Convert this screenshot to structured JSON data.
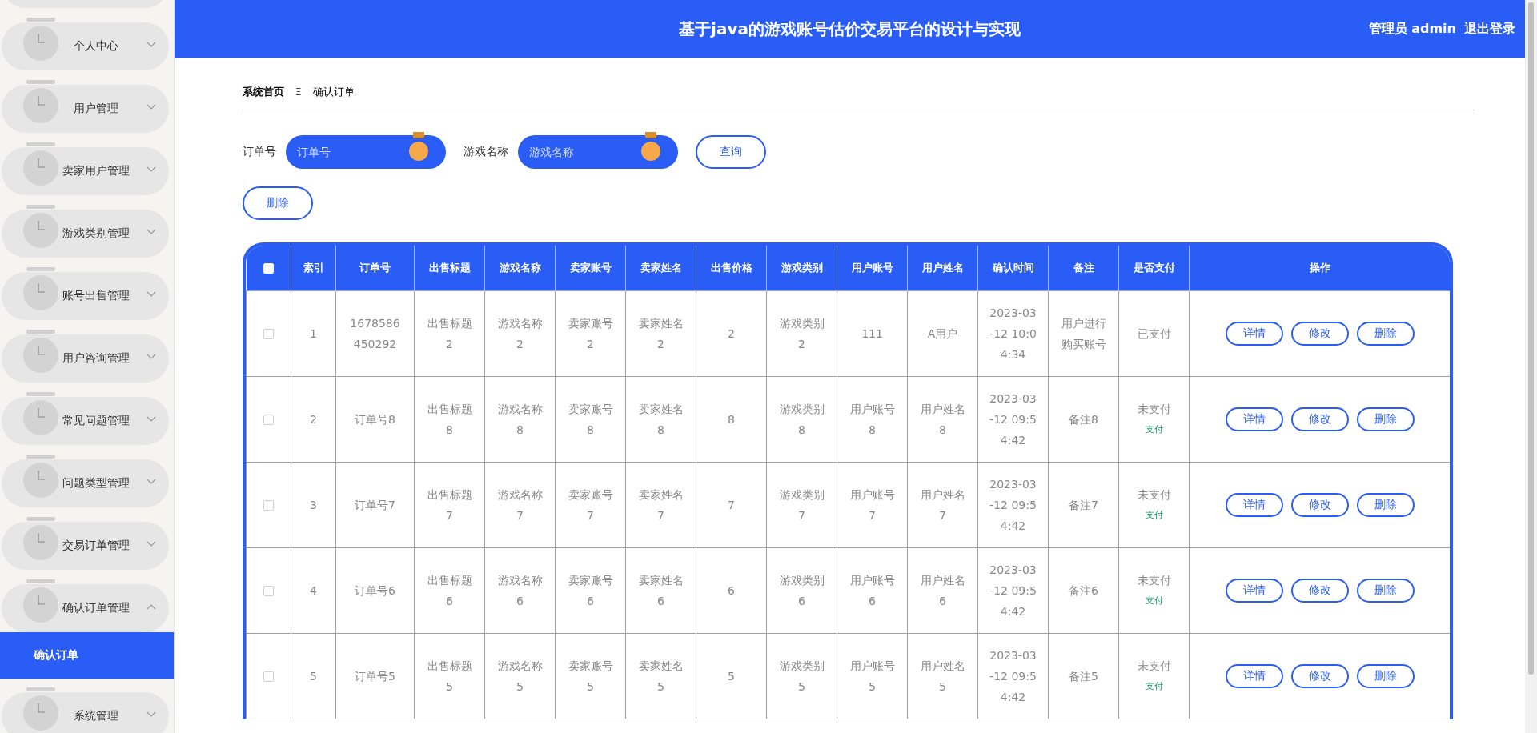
{
  "header": {
    "title": "基于java的游戏账号估价交易平台的设计与实现",
    "user": "管理员 admin",
    "logout": "退出登录"
  },
  "sidebar": {
    "items": [
      {
        "label": "个人中心",
        "expanded": false
      },
      {
        "label": "用户管理",
        "expanded": false
      },
      {
        "label": "卖家用户管理",
        "expanded": false
      },
      {
        "label": "游戏类别管理",
        "expanded": false
      },
      {
        "label": "账号出售管理",
        "expanded": false
      },
      {
        "label": "用户咨询管理",
        "expanded": false
      },
      {
        "label": "常见问题管理",
        "expanded": false
      },
      {
        "label": "问题类型管理",
        "expanded": false
      },
      {
        "label": "交易订单管理",
        "expanded": false
      },
      {
        "label": "确认订单管理",
        "expanded": true,
        "children": [
          {
            "label": "确认订单",
            "selected": true
          }
        ]
      },
      {
        "label": "系统管理",
        "expanded": false
      }
    ]
  },
  "breadcrumb": {
    "home": "系统首页",
    "separator": "Ξ",
    "current": "确认订单"
  },
  "search": {
    "fields": [
      {
        "label": "订单号",
        "placeholder": "订单号"
      },
      {
        "label": "游戏名称",
        "placeholder": "游戏名称"
      }
    ],
    "button": "查询"
  },
  "delete_button": "删除",
  "table": {
    "all_selected": false,
    "columns": [
      "索引",
      "订单号",
      "出售标题",
      "游戏名称",
      "卖家账号",
      "卖家姓名",
      "出售价格",
      "游戏类别",
      "用户账号",
      "用户姓名",
      "确认时间",
      "备注",
      "是否支付",
      "操作"
    ],
    "rows": [
      {
        "selected": false,
        "cells": [
          "1",
          "1678586450292",
          "出售标题2",
          "游戏名称2",
          "卖家账号2",
          "卖家姓名2",
          "2",
          "游戏类别2",
          "111",
          "A用户",
          "2023-03-12 10:04:34",
          "用户进行购买账号"
        ],
        "status": "已支付",
        "actions": [
          "详情",
          "修改",
          "删除"
        ]
      },
      {
        "selected": false,
        "cells": [
          "2",
          "订单号8",
          "出售标题8",
          "游戏名称8",
          "卖家账号8",
          "卖家姓名8",
          "8",
          "游戏类别8",
          "用户账号8",
          "用户姓名8",
          "2023-03-12 09:54:42",
          "备注8"
        ],
        "status": "未支付",
        "pay_link": "支付",
        "actions": [
          "详情",
          "修改",
          "删除"
        ]
      },
      {
        "selected": false,
        "cells": [
          "3",
          "订单号7",
          "出售标题7",
          "游戏名称7",
          "卖家账号7",
          "卖家姓名7",
          "7",
          "游戏类别7",
          "用户账号7",
          "用户姓名7",
          "2023-03-12 09:54:42",
          "备注7"
        ],
        "status": "未支付",
        "pay_link": "支付",
        "actions": [
          "详情",
          "修改",
          "删除"
        ]
      },
      {
        "selected": false,
        "cells": [
          "4",
          "订单号6",
          "出售标题6",
          "游戏名称6",
          "卖家账号6",
          "卖家姓名6",
          "6",
          "游戏类别6",
          "用户账号6",
          "用户姓名6",
          "2023-03-12 09:54:42",
          "备注6"
        ],
        "status": "未支付",
        "pay_link": "支付",
        "actions": [
          "详情",
          "修改",
          "删除"
        ]
      },
      {
        "selected": false,
        "cells": [
          "5",
          "订单号5",
          "出售标题5",
          "游戏名称5",
          "卖家账号5",
          "卖家姓名5",
          "5",
          "游戏类别5",
          "用户账号5",
          "用户姓名5",
          "2023-03-12 09:54:42",
          "备注5"
        ],
        "status": "未支付",
        "pay_link": "支付",
        "actions": [
          "详情",
          "修改",
          "删除"
        ]
      }
    ]
  }
}
